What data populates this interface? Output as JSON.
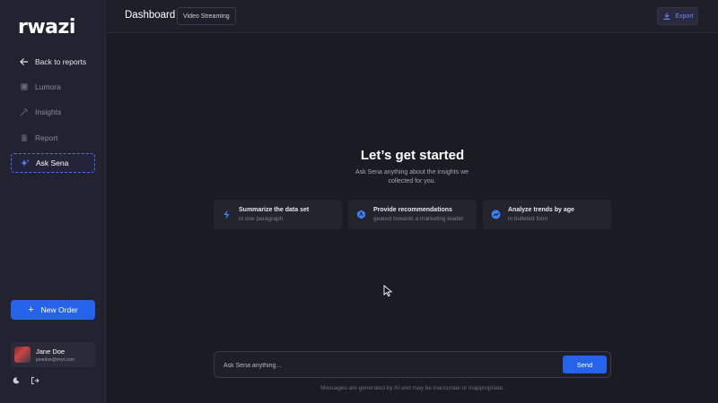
{
  "sidebar": {
    "logo": "rwazi",
    "back_label": "Back to reports",
    "items": [
      {
        "label": "Lumora",
        "icon": "database-icon"
      },
      {
        "label": "Insights",
        "icon": "sparkle-icon"
      },
      {
        "label": "Report",
        "icon": "document-icon"
      },
      {
        "label": "Ask Sena",
        "icon": "ai-sparkle-icon",
        "active": true
      }
    ],
    "new_order_label": "New Order",
    "user": {
      "name": "Jane Doe",
      "email": "janedoe@imyt.com"
    }
  },
  "header": {
    "title": "Dashboard",
    "chip": "Video Streaming",
    "export_label": "Export"
  },
  "main": {
    "heading": "Let’s get started",
    "subtitle": "Ask Sena anything about the insights we collected for you.",
    "suggestions": [
      {
        "title": "Summarize the data set",
        "subtitle": "in one paragraph",
        "icon": "lightning-icon"
      },
      {
        "title": "Provide recommendations",
        "subtitle": "geared towards a marketing leader",
        "icon": "badge-icon"
      },
      {
        "title": "Analyze trends by age",
        "subtitle": "in bulleted form",
        "icon": "trend-icon"
      }
    ],
    "chat": {
      "placeholder": "Ask Sena anything...",
      "send_label": "Send"
    },
    "disclaimer": "Messages are generated by AI and may be inaccurate or inappropriate."
  },
  "colors": {
    "accent": "#2563eb",
    "background": "#1b1b24",
    "sidebar": "#222230"
  }
}
